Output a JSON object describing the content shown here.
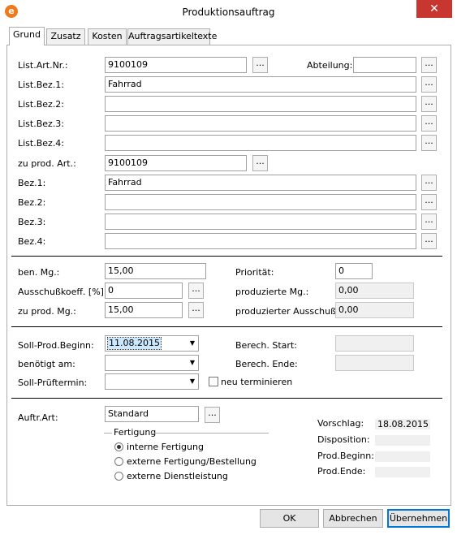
{
  "window": {
    "title": "Produktionsauftrag",
    "close": "✕"
  },
  "tabs": [
    "Grund",
    "Zusatz",
    "Kosten",
    "Auftragsartikeltexte"
  ],
  "labels": {
    "list_art_nr": "List.Art.Nr.:",
    "abteilung": "Abteilung:",
    "list_bez1": "List.Bez.1:",
    "list_bez2": "List.Bez.2:",
    "list_bez3": "List.Bez.3:",
    "list_bez4": "List.Bez.4:",
    "zu_prod_art": "zu prod. Art.:",
    "bez1": "Bez.1:",
    "bez2": "Bez.2:",
    "bez3": "Bez.3:",
    "bez4": "Bez.4:",
    "ben_mg": "ben. Mg.:",
    "prioritaet": "Priorität:",
    "ausschuss": "Ausschußkoeff. [%]:",
    "produzierte_mg": "produzierte Mg.:",
    "zu_prod_mg": "zu prod. Mg.:",
    "produzierter_ausschuss": "produzierter Ausschuß:",
    "soll_prod_beginn": "Soll-Prod.Beginn:",
    "berech_start": "Berech. Start:",
    "benoetigt_am": "benötigt am:",
    "berech_ende": "Berech. Ende:",
    "soll_prueftermin": "Soll-Prüftermin:",
    "neu_terminieren": "neu terminieren",
    "auftr_art": "Auftr.Art:",
    "fertigung": "Fertigung",
    "vorschlag": "Vorschlag:",
    "disposition": "Disposition:",
    "prod_beginn": "Prod.Beginn:",
    "prod_ende": "Prod.Ende:"
  },
  "values": {
    "list_art_nr": "9100109",
    "abteilung": "",
    "list_bez1": "Fahrrad",
    "list_bez2": "",
    "list_bez3": "",
    "list_bez4": "",
    "zu_prod_art": "9100109",
    "bez1": "Fahrrad",
    "bez2": "",
    "bez3": "",
    "bez4": "",
    "ben_mg": "15,00",
    "prioritaet": "0",
    "ausschuss": "0",
    "produzierte_mg": "0,00",
    "zu_prod_mg": "15,00",
    "produzierter_ausschuss": "0,00",
    "soll_prod_beginn": "11.08.2015",
    "berech_start": "",
    "benoetigt_am": "",
    "berech_ende": "",
    "soll_prueftermin": "",
    "auftr_art": "Standard",
    "vorschlag": "18.08.2015",
    "disposition": "",
    "prod_beginn": "",
    "prod_ende": ""
  },
  "fertigung_options": [
    "interne Fertigung",
    "externe Fertigung/Bestellung",
    "externe Dienstleistung"
  ],
  "fertigung_selected": "interne Fertigung",
  "neu_terminieren_checked": false,
  "ellipsis": "...",
  "dropdown_arrow": "▼",
  "buttons": {
    "ok": "OK",
    "cancel": "Abbrechen",
    "apply": "Übernehmen"
  }
}
